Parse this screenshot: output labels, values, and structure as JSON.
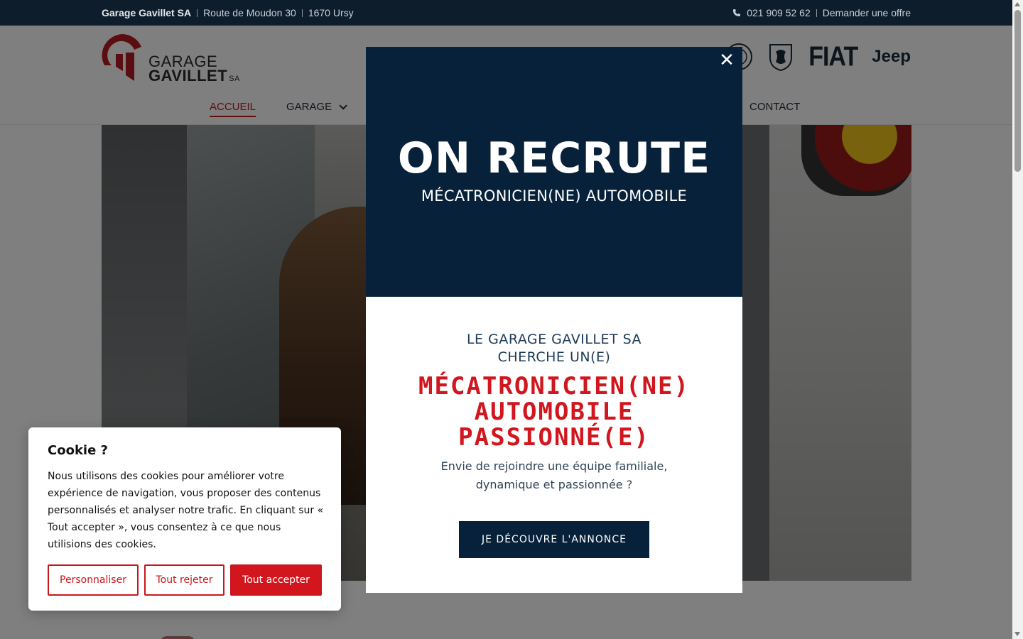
{
  "topbar": {
    "company": "Garage Gavillet SA",
    "address": "Route de Moudon 30",
    "city": "1670 Ursy",
    "phone": "021 909 52 62",
    "offer_link": "Demander une offre"
  },
  "logo": {
    "line1": "GARAGE",
    "line2": "GAVILLET",
    "suffix": "SA"
  },
  "brands": {
    "fiat": "FIAT",
    "jeep": "Jeep"
  },
  "nav": {
    "home": "ACCUEIL",
    "garage": "GARAGE",
    "contact": "CONTACT"
  },
  "modal": {
    "title": "ON RECRUTE",
    "subtitle": "MÉCATRONICIEN(NE) AUTOMOBILE",
    "lead_line1": "LE GARAGE GAVILLET SA",
    "lead_line2": "CHERCHE UN(E)",
    "job_line1": "MÉCATRONICIEN(NE)",
    "job_line2": "AUTOMOBILE",
    "job_line3": "PASSIONNÉ(E)",
    "body_line1": "Envie de rejoindre une équipe familiale,",
    "body_line2": "dynamique et passionnée ?",
    "cta": "JE DÉCOUVRE L'ANNONCE",
    "close": "✕"
  },
  "cookie": {
    "title": "Cookie ?",
    "text": "Nous utilisons des cookies pour améliorer votre expérience de navigation, vous proposer des contenus personnalisés et analyser notre trafic. En cliquant sur « Tout accepter », vous consentez à ce que nous utilisions des cookies.",
    "customize": "Personnaliser",
    "reject": "Tout rejeter",
    "accept": "Tout accepter"
  },
  "colors": {
    "navy": "#08213a",
    "red": "#d3161d",
    "topbar": "#0e1d2c"
  }
}
